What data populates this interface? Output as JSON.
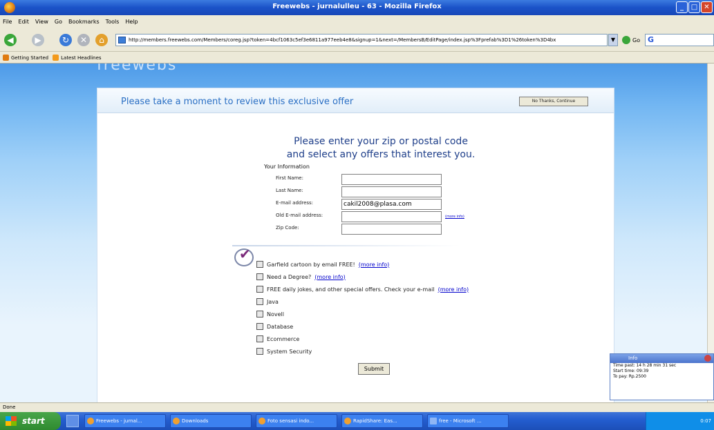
{
  "window": {
    "title": "Freewebs - jurnalulleu - 63 - Mozilla Firefox",
    "controls": [
      "_",
      "□",
      "✕"
    ]
  },
  "menu": [
    "File",
    "Edit",
    "View",
    "Go",
    "Bookmarks",
    "Tools",
    "Help"
  ],
  "nav": {
    "url": "http://members.freewebs.com/Members/coreg.jsp?token=4bcf1063c5ef3e6811a977eeb4e8&signup=1&next=/MembersB/EditPage/index.jsp%3Fprefab%3D1%26token%3D4bx",
    "go_label": "Go"
  },
  "bookmarks": [
    "Getting Started",
    "Latest Headlines"
  ],
  "page": {
    "logo_partial": "freewebs",
    "offer_message": "Please take a moment to review this exclusive offer",
    "no_thanks_label": "No Thanks, Continue",
    "headline_line1": "Please enter your zip or postal code",
    "headline_line2": "and select any offers that interest you.",
    "your_information": "Your Information",
    "fields": {
      "first_name_label": "First Name:",
      "last_name_label": "Last Name:",
      "email_label": "E-mail address:",
      "email_value": "cakil2008@plasa.com",
      "old_email_label": "Old E-mail address:",
      "zip_label": "Zip Code:"
    },
    "more_info_small": "(more info)",
    "offers": [
      {
        "label": "Garfield cartoon by email FREE!",
        "link": "(more info)"
      },
      {
        "label": "Need a Degree?",
        "link": "(more info)"
      },
      {
        "label": "FREE daily jokes, and other special offers. Check your e-mail",
        "link": "(more info)"
      },
      {
        "label": "Java",
        "link": ""
      },
      {
        "label": "Novell",
        "link": ""
      },
      {
        "label": "Database",
        "link": ""
      },
      {
        "label": "Ecommerce",
        "link": ""
      },
      {
        "label": "System Security",
        "link": ""
      }
    ],
    "submit_label": "Submit"
  },
  "info_widget": {
    "title": "Info",
    "time_past": "Time past: 14 h 28 min 31 sec",
    "start_time": "Start time: 09:39",
    "to_pay": "To pay: Rp.2500"
  },
  "status": "Done",
  "taskbar": {
    "start_label": "start",
    "buttons": [
      "Freewebs - jurnal...",
      "Downloads",
      "Foto sensasi indo...",
      "RapidShare: Eas...",
      "free - Microsoft ..."
    ],
    "clock": "0:07"
  }
}
